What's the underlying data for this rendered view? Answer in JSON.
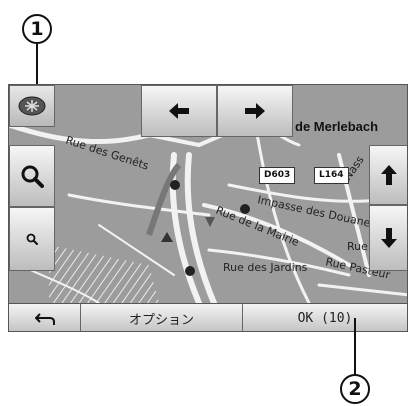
{
  "callouts": {
    "one": "1",
    "two": "2"
  },
  "map": {
    "city_label": "de Merlebach",
    "road_numbers": [
      "D603",
      "L164"
    ],
    "street_labels": {
      "genets": "Rue des Genêts",
      "douanes": "Impasse des Douanes",
      "mairie": "Rue de la Mairie",
      "jardins": "Rue des Jardins",
      "pasteur": "Rue Pasteur",
      "rue": "Rue",
      "nass": "Nass"
    }
  },
  "bottom_bar": {
    "options_label": "オプション",
    "ok_label": "OK (10)"
  },
  "colors": {
    "map_background": "#9c9c9c",
    "road": "#f2f2f2",
    "button": "#e6e6e6"
  },
  "icons": {
    "map_mode": "mode-toggle-icon",
    "left": "arrow-left-icon",
    "right": "arrow-right-icon",
    "up": "arrow-up-icon",
    "down": "arrow-down-icon",
    "zoom_in": "zoom-in-icon",
    "zoom_out": "zoom-out-icon",
    "back": "back-icon"
  }
}
